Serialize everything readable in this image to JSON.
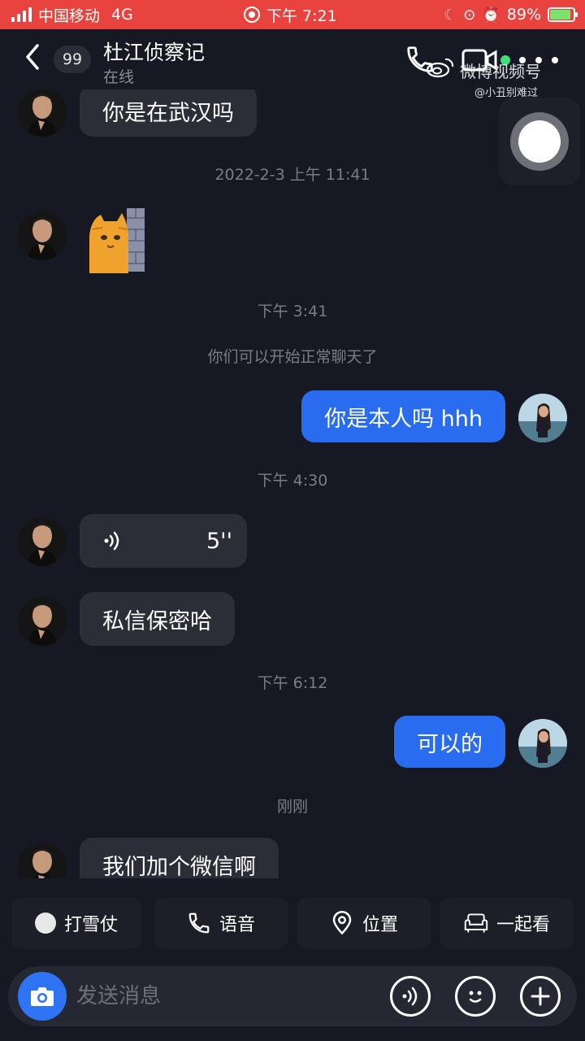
{
  "status_bar": {
    "carrier": "中国移动",
    "network": "4G",
    "time": "下午 7:21",
    "battery": "89%",
    "battery_level": 0.89
  },
  "header": {
    "unread_count": "99",
    "contact_name": "杜江侦察记",
    "contact_status": "在线",
    "icons": [
      "back-arrow-icon",
      "phone-icon",
      "video-icon",
      "more-icon"
    ]
  },
  "watermark": {
    "title": "微博视频号",
    "handle": "@小丑别难过"
  },
  "messages": {
    "m1": "你是在武汉吗",
    "ts1": "2022-2-3 上午 11:41",
    "ts2": "下午 3:41",
    "system1": "你们可以开始正常聊天了",
    "m3": "你是本人吗 hhh",
    "ts3": "下午 4:30",
    "voice_duration": "5''",
    "m5": "私信保密哈",
    "ts4": "下午 6:12",
    "m6": "可以的",
    "ts5": "刚刚",
    "m7": "我们加个微信啊"
  },
  "quick_actions": {
    "snowball": "打雪仗",
    "voice": "语音",
    "location": "位置",
    "watch": "一起看"
  },
  "input": {
    "placeholder": "发送消息"
  },
  "colors": {
    "background": "#161823",
    "status_bar": "#e8433f",
    "incoming_bubble": "#2b2d37",
    "outgoing_bubble": "#2a6cf0",
    "camera_button": "#2f74f4"
  }
}
